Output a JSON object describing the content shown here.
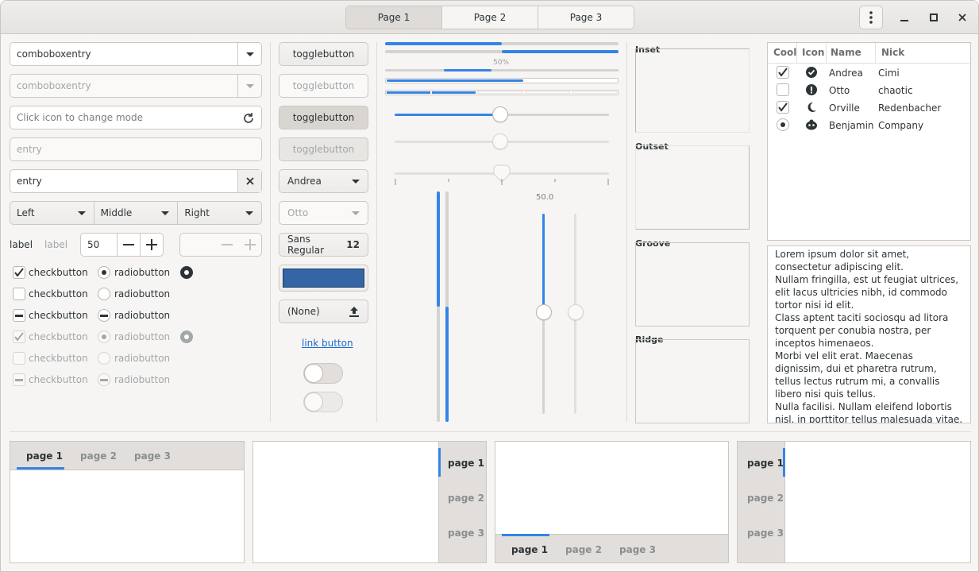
{
  "header": {
    "tabs": [
      "Page 1",
      "Page 2",
      "Page 3"
    ],
    "selected": 0
  },
  "col1": {
    "combo1": "comboboxentry",
    "combo2": "comboboxentry",
    "mode_placeholder": "Click icon to change mode",
    "entry_placeholder": "entry",
    "entry_value": "entry",
    "seg": [
      "Left",
      "Middle",
      "Right"
    ],
    "label1": "label",
    "label2": "label",
    "spin_value": "50",
    "checks": [
      "checkbutton",
      "checkbutton",
      "checkbutton",
      "checkbutton",
      "checkbutton",
      "checkbutton"
    ],
    "radios": [
      "radiobutton",
      "radiobutton",
      "radiobutton",
      "radiobutton",
      "radiobutton",
      "radiobutton"
    ]
  },
  "col2": {
    "toggles": [
      "togglebutton",
      "togglebutton",
      "togglebutton",
      "togglebutton"
    ],
    "combo_andrea": "Andrea",
    "combo_otto": "Otto",
    "font_name": "Sans Regular",
    "font_size": "12",
    "color": "#3465a4",
    "file": "(None)",
    "link": "link button"
  },
  "col3": {
    "progress_text": "50%",
    "scale_value": "50.0",
    "progress": {
      "bar1": 0.5,
      "bar2": 0.5
    }
  },
  "frames": [
    "Inset",
    "Outset",
    "Groove",
    "Ridge"
  ],
  "tree": {
    "headers": [
      "Cool",
      "Icon",
      "Name",
      "Nick"
    ],
    "rows": [
      {
        "cool": "checked",
        "icon": "check-circle-icon",
        "name": "Andrea",
        "nick": "Cimi"
      },
      {
        "cool": "unchecked",
        "icon": "exclamation-circle-icon",
        "name": "Otto",
        "nick": "chaotic"
      },
      {
        "cool": "checked",
        "icon": "moon-icon",
        "name": "Orville",
        "nick": "Redenbacher"
      },
      {
        "cool": "radio",
        "icon": "smiley-icon",
        "name": "Benjamin",
        "nick": "Company"
      }
    ]
  },
  "text": "Lorem ipsum dolor sit amet, consectetur adipiscing elit.\nNullam fringilla, est ut feugiat ultrices, elit lacus ultricies nibh, id commodo tortor nisi id elit.\nClass aptent taciti sociosqu ad litora torquent per conubia nostra, per inceptos himenaeos.\nMorbi vel elit erat. Maecenas dignissim, dui et pharetra rutrum, tellus lectus rutrum mi, a convallis libero nisi quis tellus.\nNulla facilisi. Nullam eleifend lobortis nisl, in porttitor tellus malesuada vitae.\nAenean lacus tellus, pellentesque quis molestie quis, fringilla in arcu.",
  "notebooks": {
    "nb1": [
      "page 1",
      "page 2",
      "page 3"
    ],
    "nb2": [
      "page 1",
      "page 2",
      "page 3"
    ],
    "nb3": [
      "page 1",
      "page 2",
      "page 3"
    ],
    "nb4": [
      "page 1",
      "page 2",
      "page 3"
    ]
  },
  "colors": {
    "accent": "#3584e4",
    "swatch": "#3465a4"
  }
}
